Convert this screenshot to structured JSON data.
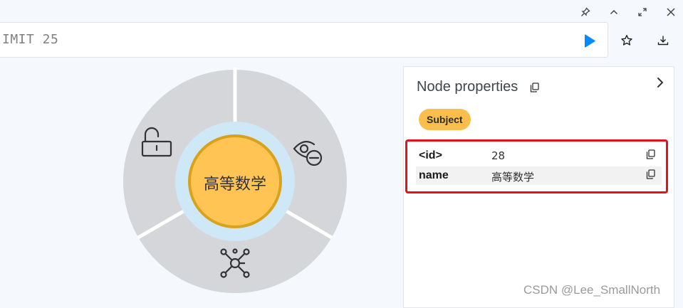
{
  "window": {
    "pin_icon": "pin-icon",
    "collapse_icon": "chevron-up-icon",
    "expand_icon": "expand-icon",
    "close_icon": "close-icon"
  },
  "query": {
    "text": "IMIT 25",
    "run_icon": "play-icon",
    "favorite_icon": "star-icon",
    "download_icon": "download-icon",
    "run_color": "#018bff"
  },
  "graph": {
    "node_label": "高等数学",
    "node_color": "#ffc454",
    "node_border": "#d9a21b",
    "halo_color": "#cfe8f8",
    "ring_color": "#d4d6da",
    "ring_actions": [
      "unlock-icon",
      "hide-icon",
      "expand-graph-icon"
    ]
  },
  "panel": {
    "title": "Node properties",
    "badge": "Subject",
    "properties": [
      {
        "key": "<id>",
        "value": "28"
      },
      {
        "key": "name",
        "value": "高等数学"
      }
    ]
  },
  "watermark": "CSDN @Lee_SmallNorth"
}
